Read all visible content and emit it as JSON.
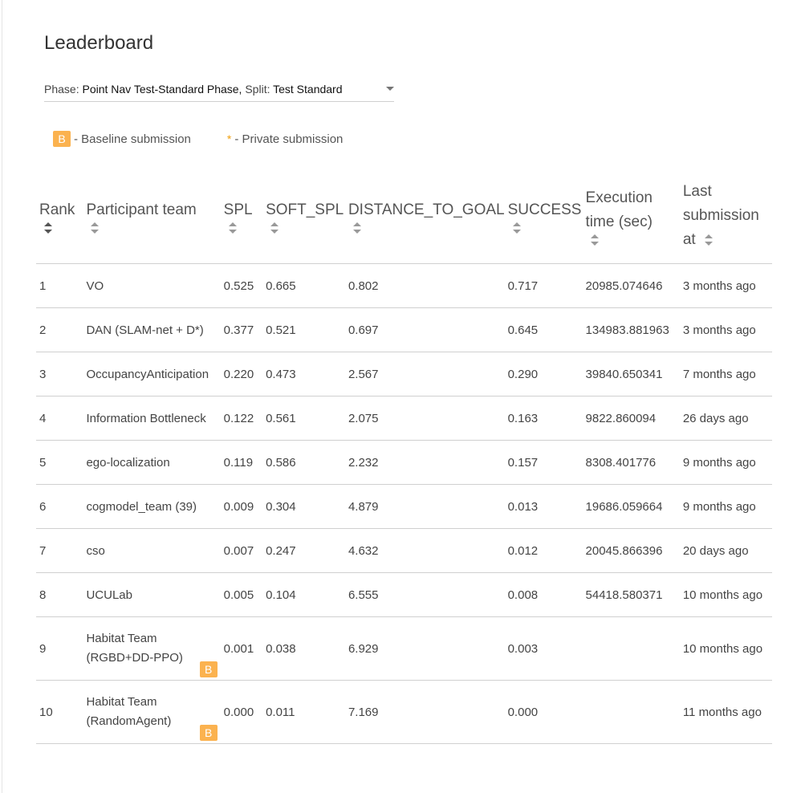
{
  "page": {
    "title": "Leaderboard"
  },
  "phase": {
    "phase_label": "Phase:",
    "phase_value": "Point Nav Test-Standard Phase,",
    "split_label": "Split:",
    "split_value": "Test Standard"
  },
  "legend": {
    "baseline_badge": "B",
    "baseline_text": "- Baseline submission",
    "private_mark": "*",
    "private_text": "- Private submission"
  },
  "columns": {
    "rank": "Rank",
    "team": "Participant team",
    "spl": "SPL",
    "soft_spl": "SOFT_SPL",
    "distance": "DISTANCE_TO_GOAL",
    "success": "SUCCESS",
    "exec_line1": "Execution",
    "exec_line2": "time (sec)",
    "last_line1": "Last",
    "last_line2": "submission",
    "last_line3": "at"
  },
  "rows": [
    {
      "rank": "1",
      "team": "VO",
      "spl": "0.525",
      "soft_spl": "0.665",
      "distance": "0.802",
      "success": "0.717",
      "exec": "20985.074646",
      "last": "3 months ago"
    },
    {
      "rank": "2",
      "team": "DAN (SLAM-net + D*)",
      "spl": "0.377",
      "soft_spl": "0.521",
      "distance": "0.697",
      "success": "0.645",
      "exec": "134983.881963",
      "last": "3 months ago"
    },
    {
      "rank": "3",
      "team": "OccupancyAnticipation",
      "spl": "0.220",
      "soft_spl": "0.473",
      "distance": "2.567",
      "success": "0.290",
      "exec": "39840.650341",
      "last": "7 months ago"
    },
    {
      "rank": "4",
      "team": "Information Bottleneck",
      "spl": "0.122",
      "soft_spl": "0.561",
      "distance": "2.075",
      "success": "0.163",
      "exec": "9822.860094",
      "last": "26 days ago"
    },
    {
      "rank": "5",
      "team": "ego-localization",
      "spl": "0.119",
      "soft_spl": "0.586",
      "distance": "2.232",
      "success": "0.157",
      "exec": "8308.401776",
      "last": "9 months ago"
    },
    {
      "rank": "6",
      "team": "cogmodel_team (39)",
      "spl": "0.009",
      "soft_spl": "0.304",
      "distance": "4.879",
      "success": "0.013",
      "exec": "19686.059664",
      "last": "9 months ago"
    },
    {
      "rank": "7",
      "team": "cso",
      "spl": "0.007",
      "soft_spl": "0.247",
      "distance": "4.632",
      "success": "0.012",
      "exec": "20045.866396",
      "last": "20 days ago"
    },
    {
      "rank": "8",
      "team": "UCULab",
      "spl": "0.005",
      "soft_spl": "0.104",
      "distance": "6.555",
      "success": "0.008",
      "exec": "54418.580371",
      "last": "10 months ago"
    },
    {
      "rank": "9",
      "team_line1": "Habitat Team",
      "team_line2": "(RGBD+DD-PPO)",
      "badge": "B",
      "spl": "0.001",
      "soft_spl": "0.038",
      "distance": "6.929",
      "success": "0.003",
      "exec": "",
      "last": "10 months ago"
    },
    {
      "rank": "10",
      "team_line1": "Habitat Team",
      "team_line2": "(RandomAgent)",
      "badge": "B",
      "spl": "0.000",
      "soft_spl": "0.011",
      "distance": "7.169",
      "success": "0.000",
      "exec": "",
      "last": "11 months ago"
    }
  ],
  "colors": {
    "badge": "#fbb24f",
    "star": "#f0a010"
  }
}
